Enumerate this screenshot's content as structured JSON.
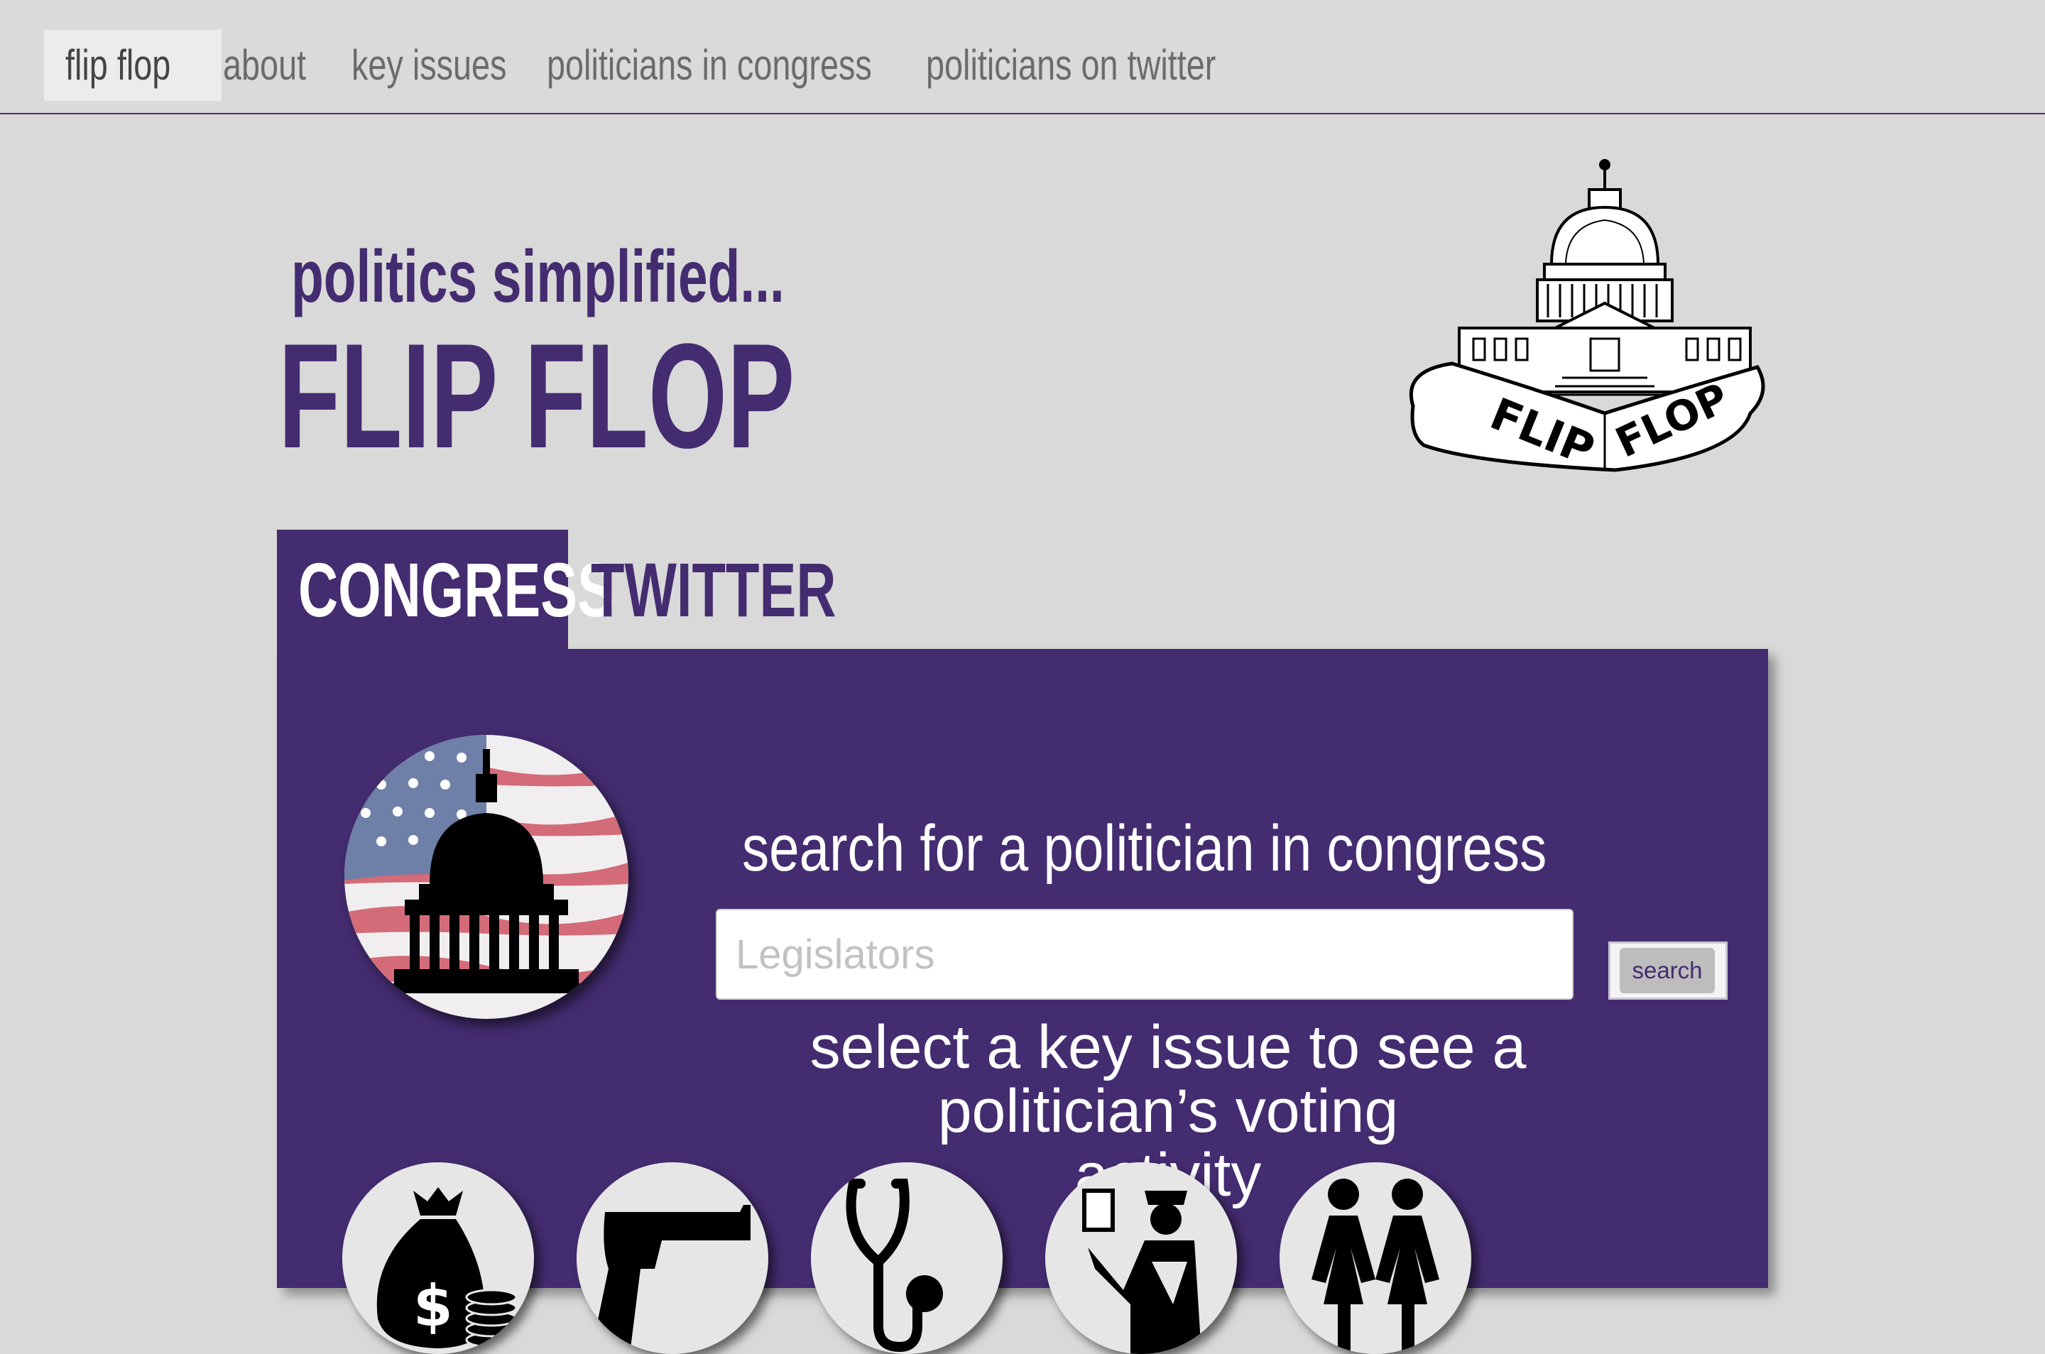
{
  "nav": {
    "brand": "flip flop",
    "items": [
      "about",
      "key issues",
      "politicians in congress",
      "politicians on twitter"
    ]
  },
  "hero": {
    "tagline": "politics simplified...",
    "title": "FLIP FLOP"
  },
  "logo": {
    "text_left": "FLIP",
    "text_right": "FLOP"
  },
  "tabs": [
    {
      "label": "CONGRESS",
      "active": true
    },
    {
      "label": "TWITTER",
      "active": false
    }
  ],
  "search": {
    "heading": "search for a politician in congress",
    "placeholder": "Legislators",
    "button": "search"
  },
  "issues": {
    "heading_line1": "select a key issue to see a politician’s voting",
    "heading_line2": "activity",
    "icons": [
      "money-bag-icon",
      "gun-icon",
      "stethoscope-icon",
      "immigration-officer-icon",
      "couple-icon"
    ]
  },
  "colors": {
    "brand_purple": "#442c70",
    "background": "#d9d9d9"
  }
}
